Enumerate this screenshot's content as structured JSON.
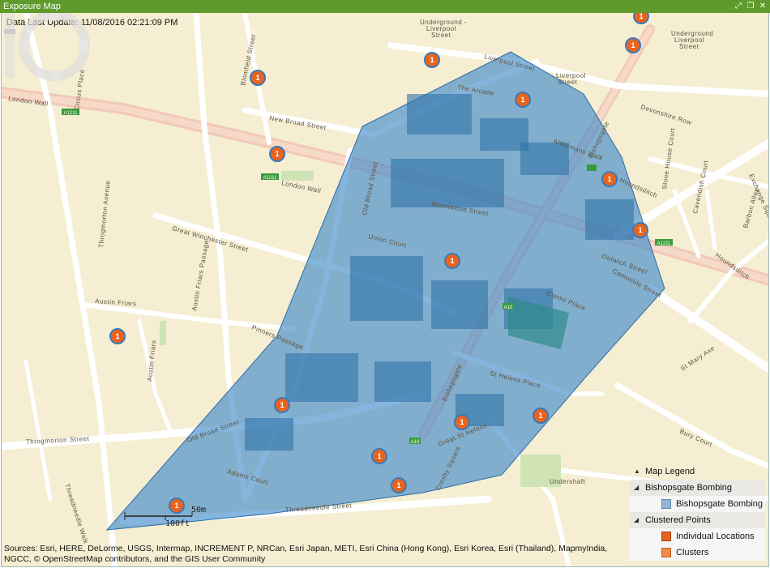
{
  "window": {
    "title": "Exposure Map"
  },
  "map": {
    "last_update": "Data Last Update: 11/08/2016 02:21:09 PM",
    "sources": "Sources: Esri, HERE, DeLorme, USGS, Intermap, INCREMENT P, NRCan, Esri Japan, METI, Esri China (Hong Kong), Esri Korea, Esri (Thailand), MapmyIndia, NGCC, © OpenStreetMap contributors, and the GIS User Community",
    "scale_m": "50m",
    "scale_ft": "100ft",
    "marker_label": "1",
    "road_labels": {
      "london_wall": "London Wall",
      "london_wall_2": "London Wall",
      "new_broad": "New Broad Street",
      "liverpool": "Liverpool Street",
      "old_broad_n": "Old Broad Street",
      "old_broad_s": "Old Broad Street",
      "wormwood": "Wormwood Street",
      "union_court": "Union Court",
      "great_winchester": "Great Winchester Street",
      "austin_friars": "Austin Friars",
      "austin_friars_v": "Austin Friars",
      "austin_friars_passage": "Austin Friars Passage",
      "throgmorton_ave": "Throgmorton Avenue",
      "throgmorton_st": "Throgmorton Street",
      "threadneedle": "Threadneedle Street",
      "threadneedle_walk": "Threadneedle Walk",
      "adams_court": "Adams Court",
      "pinners_passage": "Pinners Passage",
      "bishopsgate_n": "Bishopsgate",
      "bishopsgate_s": "Bishopsgate",
      "st_helens_place": "St Helens Place",
      "great_st_helens": "Great St Helens",
      "crosby_square": "Crosby Square",
      "undershaft": "Undershaft",
      "st_mary_axe": "St Mary Axe",
      "bury_court": "Bury Court",
      "camomile": "Camomile Street",
      "outwich": "Outwich Street",
      "clerks_place": "Clerks Place",
      "houndsditch": "Houndsditch",
      "houndsditch_2": "Houndsditch",
      "devonshire_row": "Devonshire Row",
      "stone_house": "Stone House Court",
      "cavendish": "Cavendish Court",
      "barbon": "Barbon Alley",
      "the_arcade": "The Arcade",
      "aldermans_walk": "Aldermans Walk",
      "circus_place": "Circus Place",
      "blomfield": "Blomfield Street",
      "exchange_sq": "Exchange Square",
      "underground_1": "Underground -",
      "underground_2": "Liverpool",
      "underground_3": "Street",
      "underground_b1": "Underground",
      "underground_b2": "Liverpool",
      "underground_b3": "Street",
      "liverpool_st_2": "Liverpool",
      "liverpool_st_3": "Street",
      "a1211": "A1211",
      "a1211_b": "A1211",
      "a10": "A10",
      "a10_b": "A10",
      "a1211_c": "A1211"
    }
  },
  "legend": {
    "title": "Map Legend",
    "group1": "Bishopsgate Bombing",
    "group1_item": "Bishopsgate Bombing",
    "group2": "Clustered Points",
    "group2_item1": "Individual Locations",
    "group2_item2": "Clusters"
  },
  "colors": {
    "titlebar": "#5e9b2c",
    "polygon_fill": "#3a86c8",
    "marker": "#e8641e",
    "cluster": "#f08a4b",
    "legend_poly": "#8fb4d8"
  }
}
